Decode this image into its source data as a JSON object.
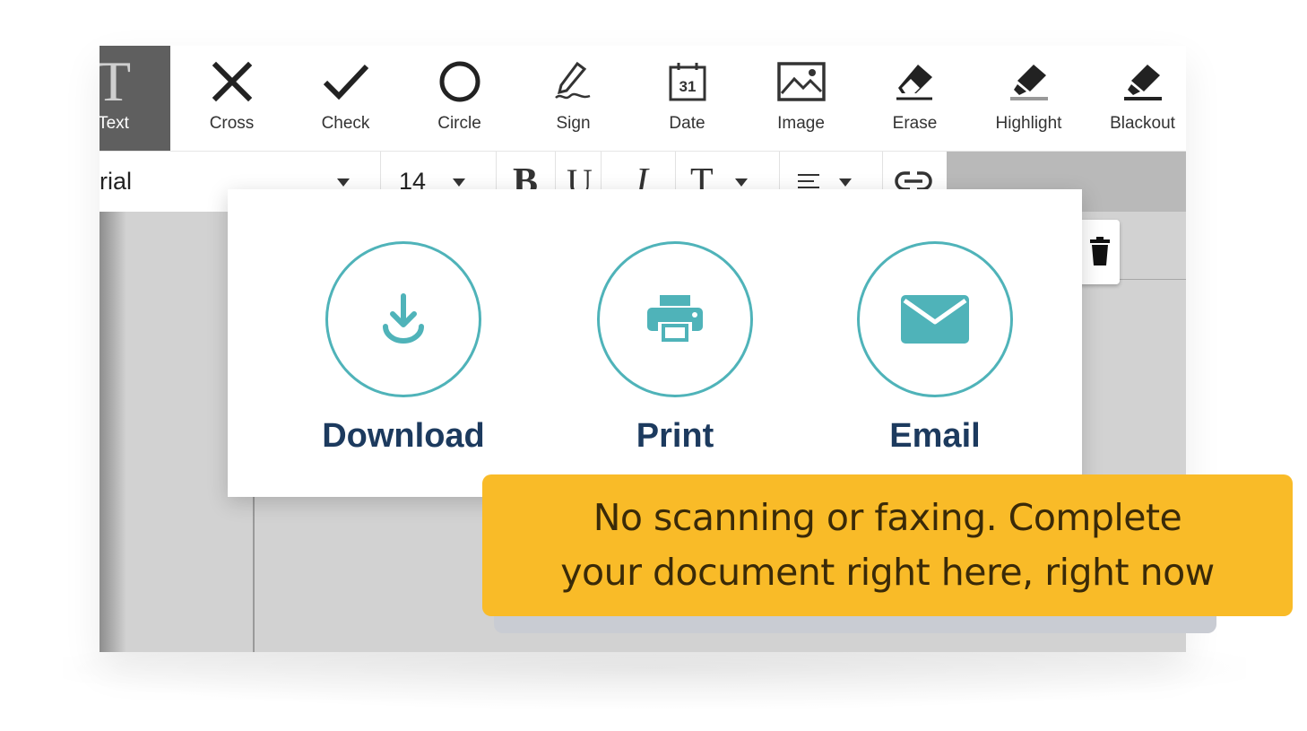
{
  "toolbar": {
    "tools": [
      {
        "label": "Text",
        "icon": "text-icon",
        "active": true
      },
      {
        "label": "Cross",
        "icon": "cross-icon"
      },
      {
        "label": "Check",
        "icon": "check-icon"
      },
      {
        "label": "Circle",
        "icon": "circle-icon"
      },
      {
        "label": "Sign",
        "icon": "sign-icon"
      },
      {
        "label": "Date",
        "icon": "calendar-icon",
        "date_number": "31"
      },
      {
        "label": "Image",
        "icon": "image-icon"
      },
      {
        "label": "Erase",
        "icon": "eraser-icon"
      },
      {
        "label": "Highlight",
        "icon": "highlighter-icon"
      },
      {
        "label": "Blackout",
        "icon": "blackout-marker-icon"
      }
    ]
  },
  "format": {
    "font_name": "Arial",
    "font_size": "14",
    "bold": "B",
    "underline": "U",
    "italic": "I",
    "text_color": "T"
  },
  "modal": {
    "actions": [
      {
        "label": "Download",
        "icon": "download-icon"
      },
      {
        "label": "Print",
        "icon": "printer-icon"
      },
      {
        "label": "Email",
        "icon": "envelope-icon"
      }
    ],
    "accent_color": "#4fb3b9",
    "label_color": "#1c3a5e"
  },
  "callout": {
    "line1": "No scanning or faxing. Complete",
    "line2": "your document right here, right now",
    "background": "#f9bb28"
  }
}
